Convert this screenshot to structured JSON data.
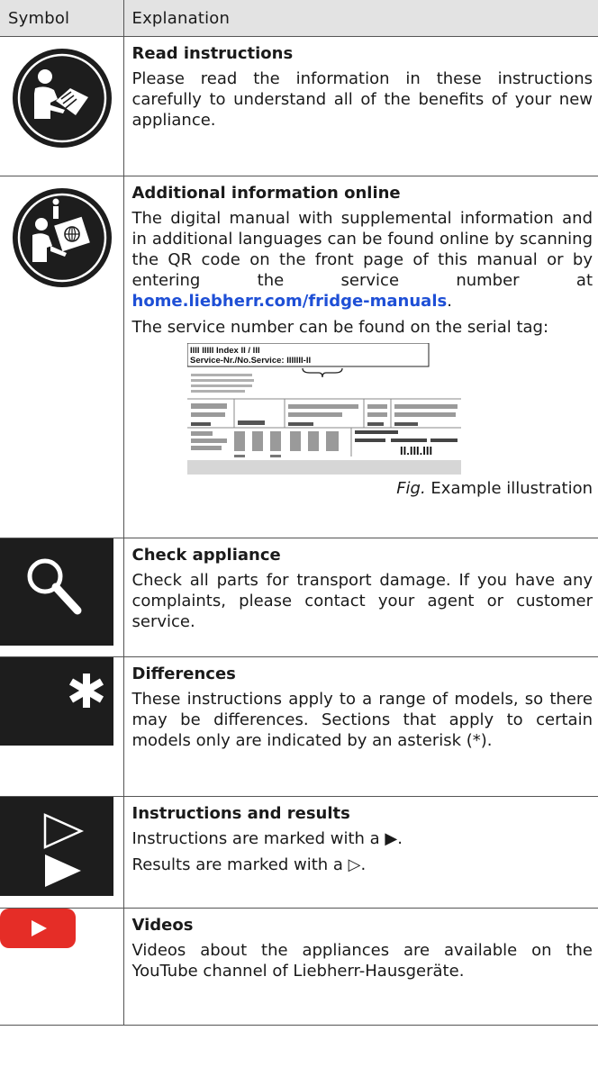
{
  "header": {
    "symbol": "Symbol",
    "explanation": "Explanation"
  },
  "rows": [
    {
      "icon": "read-instructions-icon",
      "title": "Read instructions",
      "text": "Please read the information in these instructions carefully to understand all of the benefits of your new appliance."
    },
    {
      "icon": "additional-info-online-icon",
      "title": "Additional information online",
      "text_before_link": "The digital manual with supplemental information and in additional languages can be found online by scanning the QR code on the front page of this manual or by entering the service number at ",
      "link": "home.liebherr.com/fridge-manuals",
      "text_after_link": ".",
      "text2": "The service number can be found on the serial tag:",
      "figure": {
        "line1": "IIII IIIII  Index  II / III",
        "line2": "Service-Nr./No.Service: IIIIIII-II",
        "bottom_right": "II.III.III"
      },
      "caption_prefix": "Fig.",
      "caption": " Example illustration"
    },
    {
      "icon": "magnifier-icon",
      "title": "Check appliance",
      "text": "Check all parts for transport damage. If you have any complaints, please contact your agent or customer service."
    },
    {
      "icon": "asterisk-icon",
      "title": "Differences",
      "text": "These instructions apply to a range of models, so there may be differences. Sections that apply to certain models only are indicated by an asterisk (*)."
    },
    {
      "icon": "instruction-result-arrows-icon",
      "title": "Instructions and results",
      "text": "Instructions are marked with a ▶.",
      "text2": "Results are marked with a ▷."
    },
    {
      "icon": "youtube-icon",
      "title": "Videos",
      "text": "Videos about the appliances are available on the YouTube channel of Liebherr-Hausgeräte."
    }
  ],
  "colors": {
    "youtube_red": "#e52d27",
    "link_blue": "#1e4fd6",
    "header_bg": "#e3e3e3",
    "icon_dark": "#1d1d1d"
  }
}
